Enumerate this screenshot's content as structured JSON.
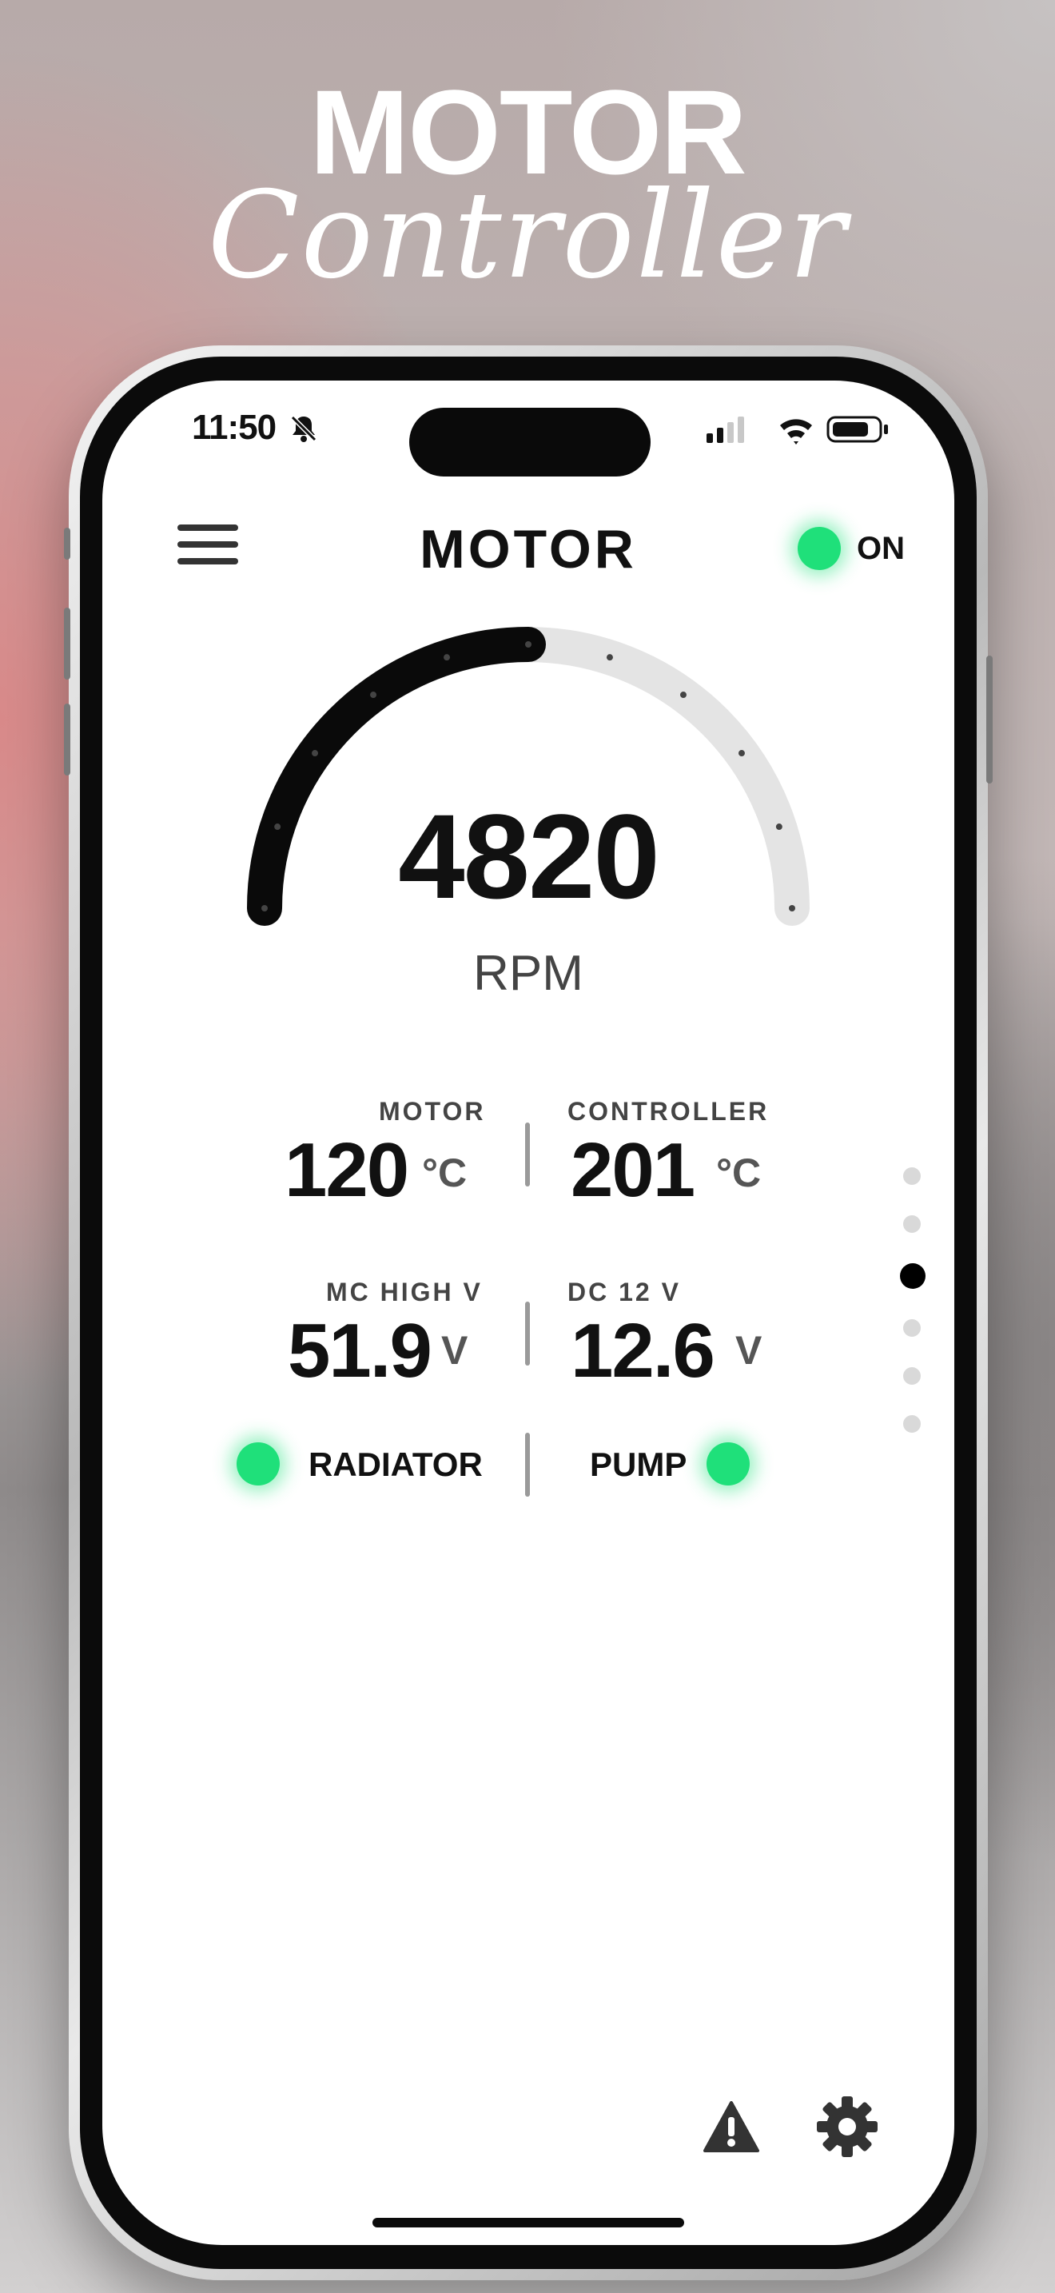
{
  "promo": {
    "title_top": "MOTOR",
    "title_script": "Controller"
  },
  "status_bar": {
    "time": "11:50",
    "icons": [
      "bell-slash-icon",
      "signal-icon",
      "wifi-icon",
      "battery-icon"
    ]
  },
  "header": {
    "title": "MOTOR",
    "menu_icon": "hamburger-menu-icon",
    "power_label": "ON",
    "power_state": "on"
  },
  "gauge": {
    "value": "4820",
    "unit": "RPM",
    "fill_fraction": 0.5
  },
  "metrics": [
    {
      "label": "MOTOR",
      "value": "120",
      "unit": "°C"
    },
    {
      "label": "CONTROLLER",
      "value": "201",
      "unit": "°C"
    },
    {
      "label": "MC HIGH V",
      "value": "51.9",
      "unit": "V"
    },
    {
      "label": "DC 12 V",
      "value": "12.6",
      "unit": "V"
    }
  ],
  "indicators": [
    {
      "label": "RADIATOR",
      "state": "on"
    },
    {
      "label": "PUMP",
      "state": "on"
    }
  ],
  "pager": {
    "count": 6,
    "active_index": 2
  },
  "bottom_bar": {
    "icons": [
      "warning-icon",
      "gear-icon"
    ]
  },
  "colors": {
    "accent_green": "#1fe07a",
    "gauge_fill": "#0a0a0a",
    "gauge_track": "#e4e4e4"
  }
}
